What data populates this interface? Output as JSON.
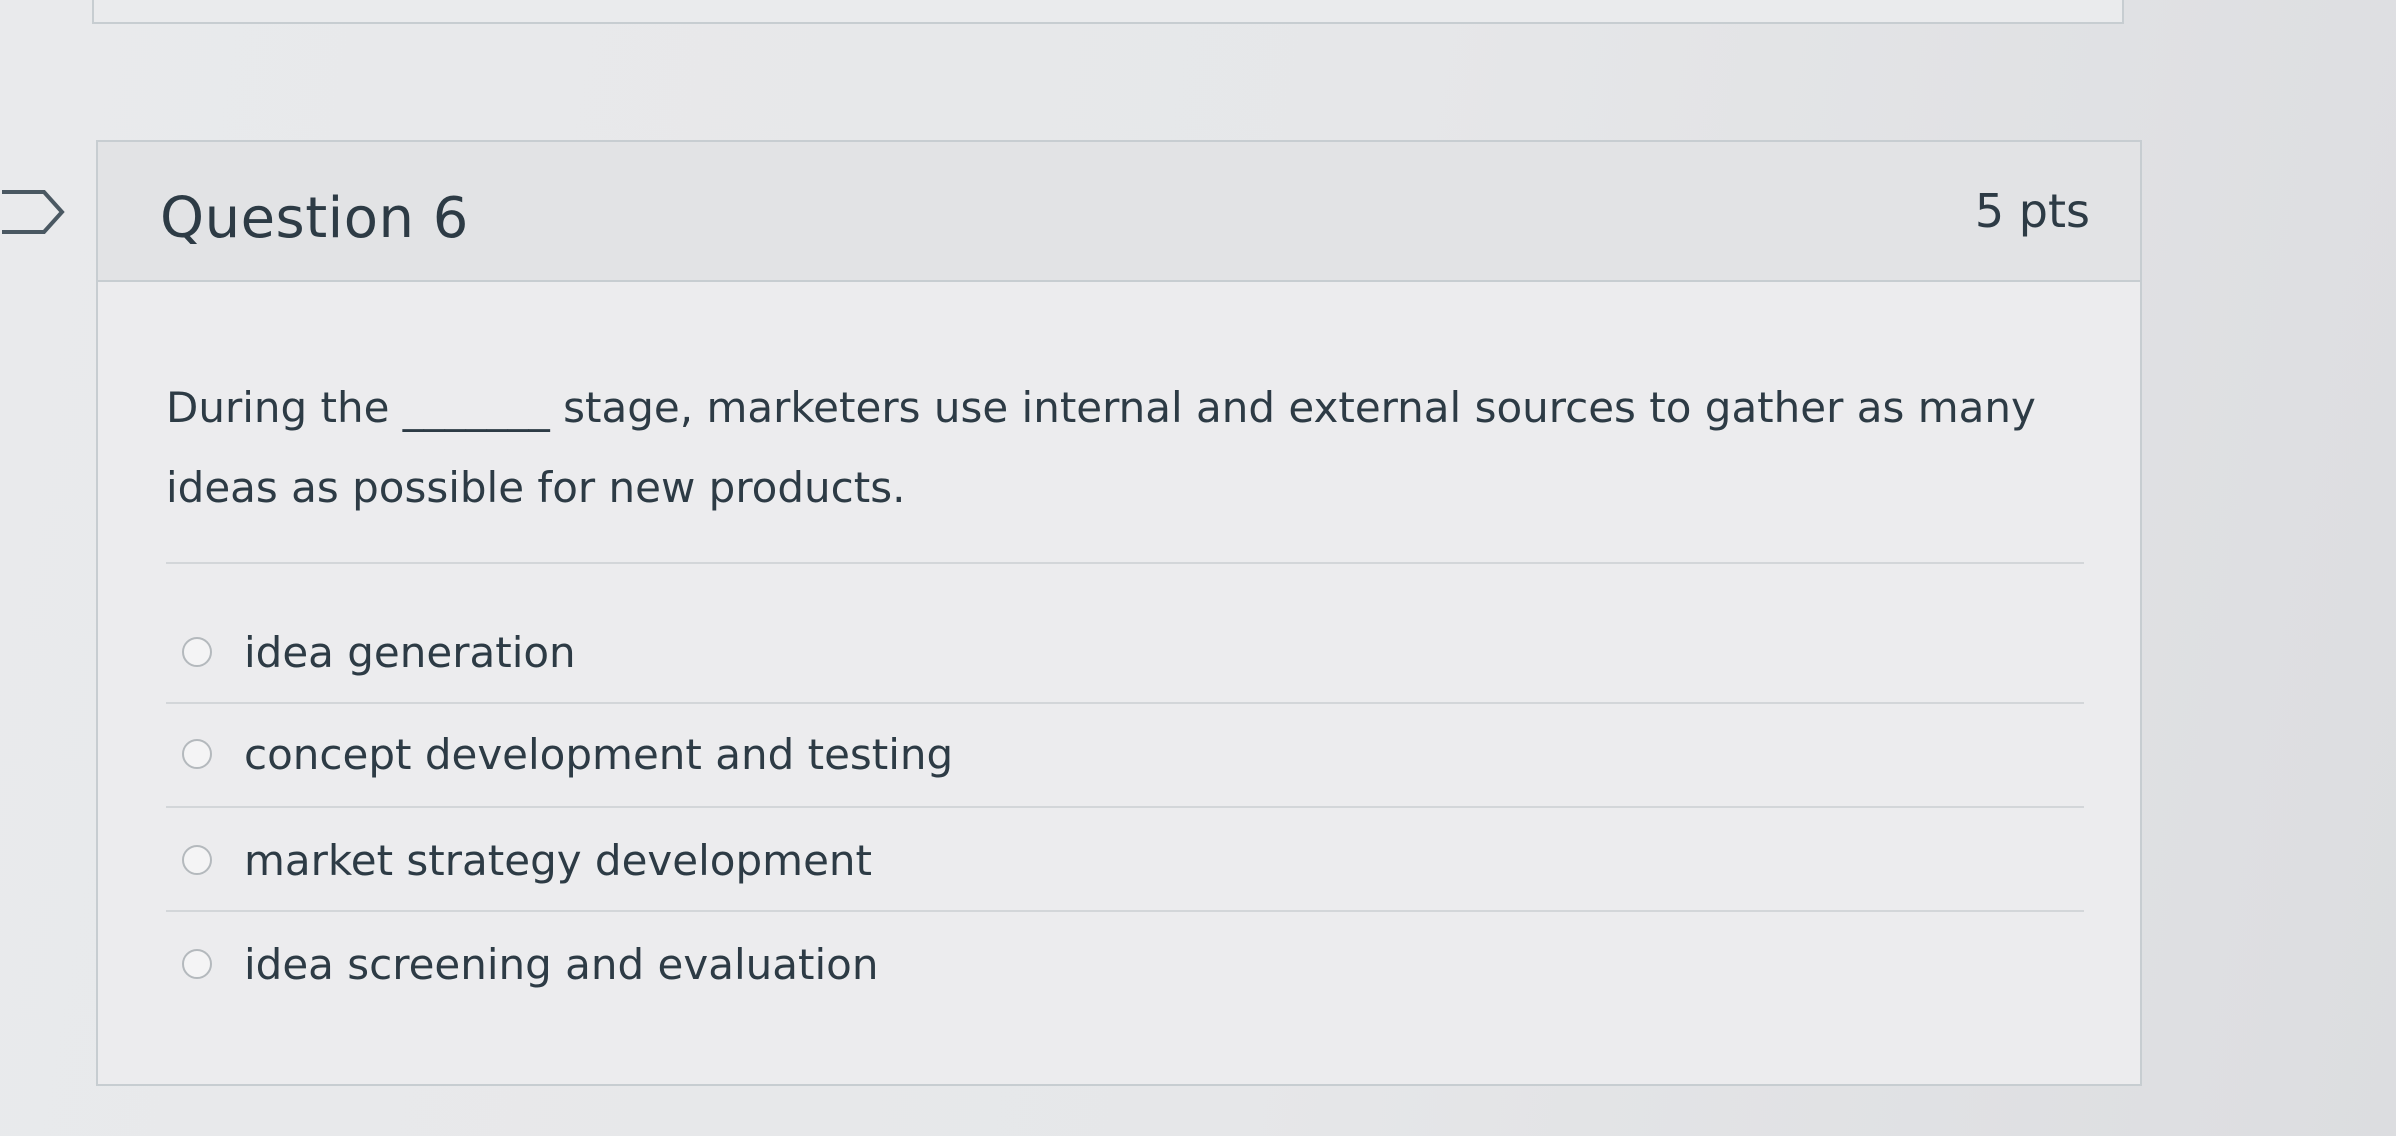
{
  "question": {
    "title": "Question 6",
    "points": "5 pts",
    "text": "During the _______ stage, marketers use internal and external sources to gather as many ideas as possible for new products.",
    "answers": [
      {
        "label": "idea generation"
      },
      {
        "label": "concept development and testing"
      },
      {
        "label": "market strategy development"
      },
      {
        "label": "idea screening and evaluation"
      }
    ]
  },
  "colors": {
    "text": "#2d3b45",
    "border": "#c7cdd1",
    "header_bg": "#e2e3e5"
  },
  "icons": {
    "bookmark": "bookmark-flag-icon",
    "radio": "radio-button-icon"
  }
}
